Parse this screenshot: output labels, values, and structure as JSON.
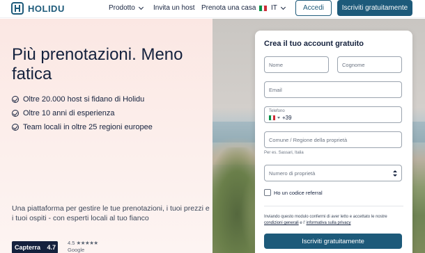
{
  "header": {
    "logo_text": "HOLIDU",
    "nav": [
      {
        "label": "Prodotto",
        "has_dropdown": true
      },
      {
        "label": "Invita un host",
        "has_dropdown": false
      },
      {
        "label": "Prenota una casa",
        "has_dropdown": false
      }
    ],
    "language": {
      "code": "IT",
      "flag_colors": [
        "#009246",
        "#ffffff",
        "#ce2b37"
      ]
    },
    "login_label": "Accedi",
    "signup_label": "Iscriviti gratuitamente"
  },
  "hero": {
    "title": "Più prenotazioni. Meno fatica",
    "bullets": [
      "Oltre 20.000 host si fidano di Holidu",
      "Oltre 10 anni di esperienza",
      "Team locali in oltre 25 regioni europee"
    ],
    "description": "Una piattaforma per gestire le tue prenotazioni, i tuoi prezzi e i tuoi ospiti - con esperti locali al tuo fianco",
    "capterra": {
      "label": "Capterra",
      "score": "4.7"
    },
    "google": {
      "score": "4.5",
      "stars": "★★★★★",
      "label": "Google"
    }
  },
  "form": {
    "title": "Crea il tuo account gratuito",
    "first_name_placeholder": "Nome",
    "last_name_placeholder": "Cognome",
    "email_placeholder": "Email",
    "phone_label": "Telefono",
    "phone_prefix": "+39",
    "location_placeholder": "Comune / Regione della proprietà",
    "location_hint": "Per es. Sassari, Italia",
    "property_count_placeholder": "Numero di proprietà",
    "referral_label": "Ho un codice referral",
    "legal_prefix": "Inviando questo modulo confermi di aver letto e accettato le nostre",
    "legal_terms": "condizioni generali",
    "legal_and": "e l'",
    "legal_privacy": "informativa sulla privacy",
    "submit_label": "Iscriviti gratuitamente"
  },
  "colors": {
    "brand": "#1d5a7a",
    "hero_bg": "#fbe7e3",
    "text": "#14213d"
  }
}
